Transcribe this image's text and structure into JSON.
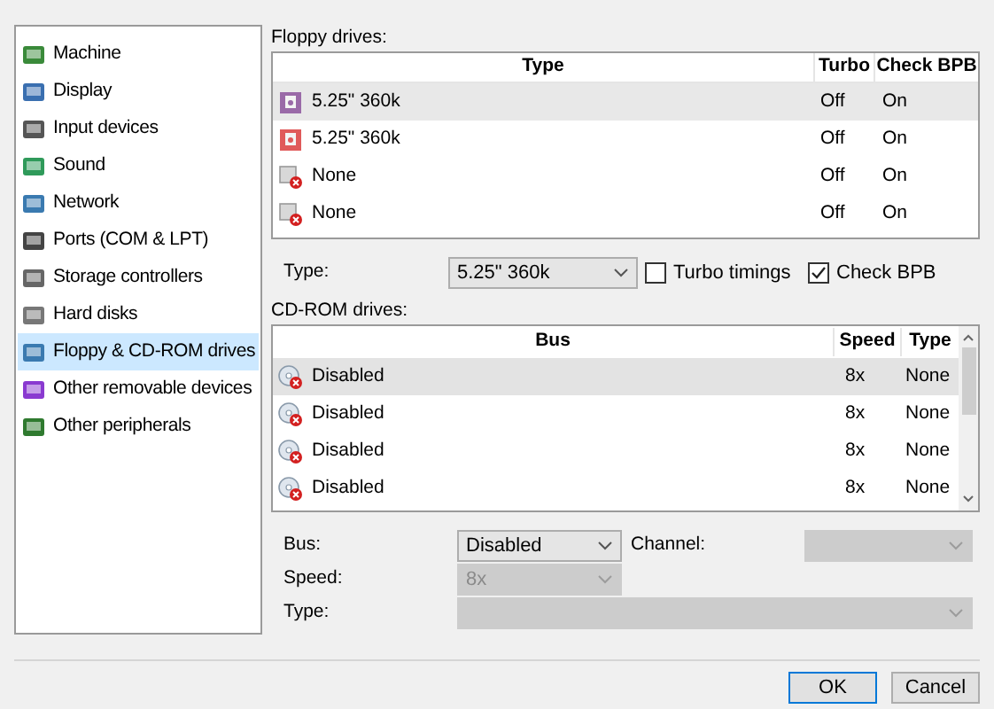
{
  "sidebar": {
    "items": [
      {
        "label": "Machine",
        "selected": false,
        "color": "#3a8a3a"
      },
      {
        "label": "Display",
        "selected": false,
        "color": "#3a6fb0"
      },
      {
        "label": "Input devices",
        "selected": false,
        "color": "#555555"
      },
      {
        "label": "Sound",
        "selected": false,
        "color": "#2f9a5a"
      },
      {
        "label": "Network",
        "selected": false,
        "color": "#3a7ab0"
      },
      {
        "label": "Ports (COM & LPT)",
        "selected": false,
        "color": "#444444"
      },
      {
        "label": "Storage controllers",
        "selected": false,
        "color": "#666666"
      },
      {
        "label": "Hard disks",
        "selected": false,
        "color": "#777777"
      },
      {
        "label": "Floppy & CD-ROM drives",
        "selected": true,
        "color": "#3a7ab0"
      },
      {
        "label": "Other removable devices",
        "selected": false,
        "color": "#8a3ad0"
      },
      {
        "label": "Other peripherals",
        "selected": false,
        "color": "#2f7a2f"
      }
    ]
  },
  "floppy": {
    "label": "Floppy drives:",
    "columns": [
      "Type",
      "Turbo",
      "Check BPB"
    ],
    "rows": [
      {
        "kind": "floppy",
        "color": "#9a6aa8",
        "type": "5.25\" 360k",
        "turbo": "Off",
        "check_bpb": "On",
        "selected": true
      },
      {
        "kind": "floppy",
        "color": "#e05a5a",
        "type": "5.25\" 360k",
        "turbo": "Off",
        "check_bpb": "On",
        "selected": false
      },
      {
        "kind": "empty",
        "type": "None",
        "turbo": "Off",
        "check_bpb": "On",
        "selected": false
      },
      {
        "kind": "empty",
        "type": "None",
        "turbo": "Off",
        "check_bpb": "On",
        "selected": false
      }
    ],
    "type_label": "Type:",
    "type_value": "5.25\" 360k",
    "turbo_timings": {
      "label": "Turbo timings",
      "checked": false
    },
    "check_bpb": {
      "label": "Check BPB",
      "checked": true
    }
  },
  "cdrom": {
    "label": "CD-ROM drives:",
    "columns": [
      "Bus",
      "Speed",
      "Type"
    ],
    "rows": [
      {
        "bus": "Disabled",
        "speed": "8x",
        "type": "None",
        "selected": true
      },
      {
        "bus": "Disabled",
        "speed": "8x",
        "type": "None",
        "selected": false
      },
      {
        "bus": "Disabled",
        "speed": "8x",
        "type": "None",
        "selected": false
      },
      {
        "bus": "Disabled",
        "speed": "8x",
        "type": "None",
        "selected": false
      }
    ],
    "bus": {
      "label": "Bus:",
      "value": "Disabled",
      "disabled": false
    },
    "channel": {
      "label": "Channel:",
      "disabled": true
    },
    "speed": {
      "label": "Speed:",
      "value": "8x",
      "disabled": true
    },
    "type": {
      "label": "Type:",
      "disabled": true
    }
  },
  "buttons": [
    "OK",
    "Cancel"
  ]
}
